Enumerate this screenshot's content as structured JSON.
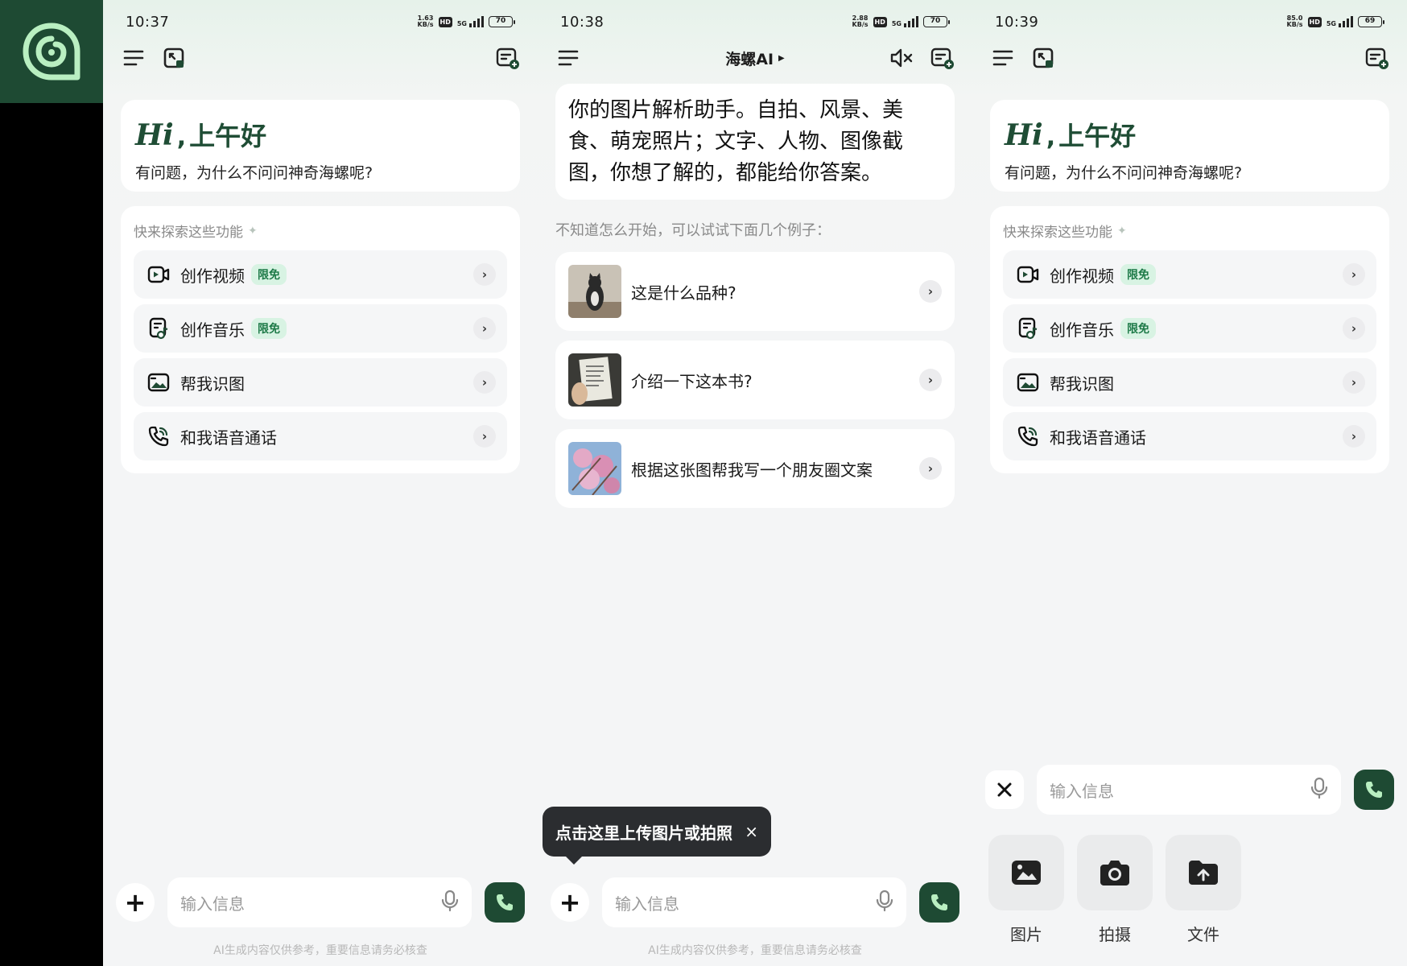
{
  "app": {
    "logo_icon": "snail-spiral-icon",
    "brand_color": "#1e4a33"
  },
  "screens": [
    {
      "status": {
        "time": "10:37",
        "net_rate": "1.63",
        "net_unit": "KB/s",
        "hd": "HD",
        "network": "5G",
        "battery": "70"
      },
      "greeting": {
        "hi": "Hi",
        "comma": ",",
        "title": "上午好",
        "subtitle": "有问题，为什么不问问神奇海螺呢?"
      },
      "explore": {
        "title": "快来探索这些功能",
        "items": [
          {
            "label": "创作视频",
            "badge": "限免",
            "icon": "video-icon"
          },
          {
            "label": "创作音乐",
            "badge": "限免",
            "icon": "music-note-icon"
          },
          {
            "label": "帮我识图",
            "badge": "",
            "icon": "image-icon"
          },
          {
            "label": "和我语音通话",
            "badge": "",
            "icon": "phone-call-icon"
          }
        ]
      },
      "input": {
        "placeholder": "输入信息"
      },
      "disclaimer": "AI生成内容仅供参考，重要信息请务必核查"
    },
    {
      "status": {
        "time": "10:38",
        "net_rate": "2.88",
        "net_unit": "KB/s",
        "hd": "HD",
        "network": "5G",
        "battery": "70"
      },
      "title": "海螺AI",
      "intro": "你的图片解析助手。自拍、风景、美食、萌宠照片；文字、人物、图像截图，你想了解的，都能给你答案。",
      "examples_hint": "不知道怎么开始，可以试试下面几个例子：",
      "examples": [
        {
          "label": "这是什么品种?",
          "thumb": "cat-photo"
        },
        {
          "label": "介绍一下这本书?",
          "thumb": "book-photo"
        },
        {
          "label": "根据这张图帮我写一个朋友圈文案",
          "thumb": "blossom-photo"
        }
      ],
      "tooltip": {
        "text": "点击这里上传图片或拍照",
        "close": "×"
      },
      "input": {
        "placeholder": "输入信息"
      },
      "disclaimer": "AI生成内容仅供参考，重要信息请务必核查"
    },
    {
      "status": {
        "time": "10:39",
        "net_rate": "85.0",
        "net_unit": "KB/s",
        "hd": "HD",
        "network": "5G",
        "battery": "69"
      },
      "greeting": {
        "hi": "Hi",
        "comma": ",",
        "title": "上午好",
        "subtitle": "有问题，为什么不问问神奇海螺呢?"
      },
      "explore": {
        "title": "快来探索这些功能",
        "items": [
          {
            "label": "创作视频",
            "badge": "限免",
            "icon": "video-icon"
          },
          {
            "label": "创作音乐",
            "badge": "限免",
            "icon": "music-note-icon"
          },
          {
            "label": "帮我识图",
            "badge": "",
            "icon": "image-icon"
          },
          {
            "label": "和我语音通话",
            "badge": "",
            "icon": "phone-call-icon"
          }
        ]
      },
      "input": {
        "placeholder": "输入信息"
      },
      "attachments": [
        {
          "label": "图片",
          "icon": "picture-icon"
        },
        {
          "label": "拍摄",
          "icon": "camera-icon"
        },
        {
          "label": "文件",
          "icon": "file-upload-icon"
        }
      ]
    }
  ]
}
